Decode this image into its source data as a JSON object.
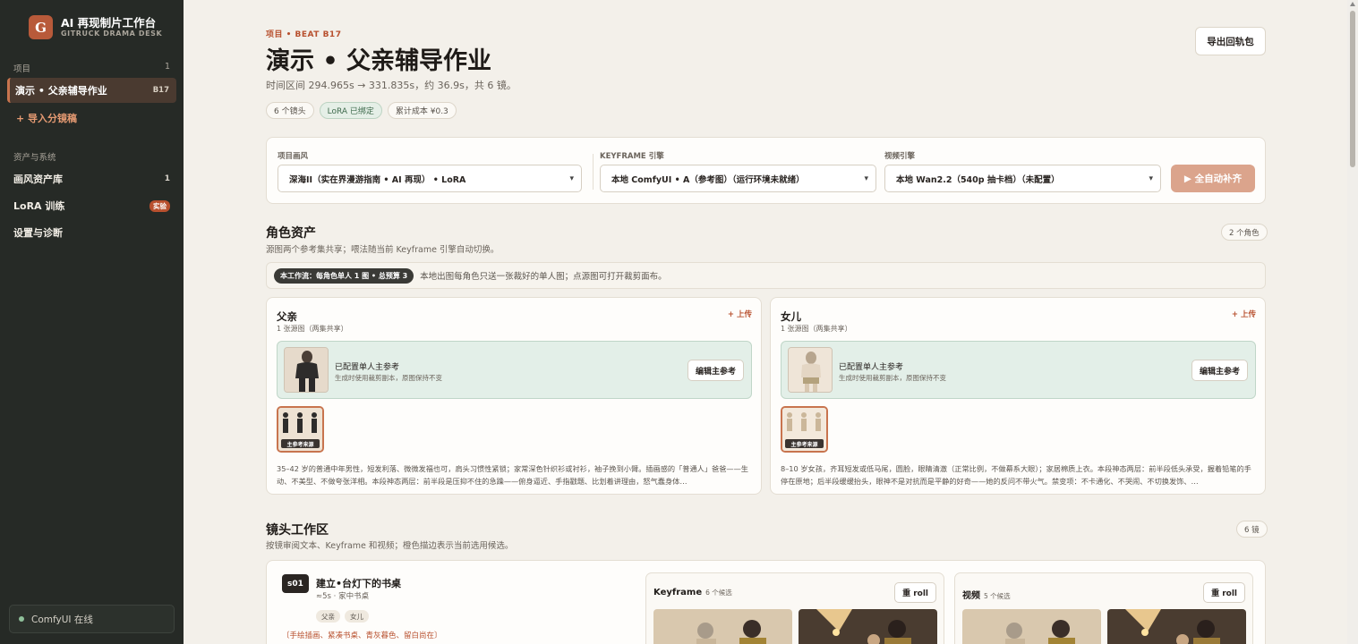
{
  "sidebar": {
    "brand_logo": "G",
    "brand_title": "AI 再现制片工作台",
    "brand_sub": "GITRUCK DRAMA DESK",
    "projects_label": "项目",
    "projects_count": "1",
    "active_project": "演示 • 父亲辅导作业",
    "active_badge": "B17",
    "import_label": "+ 导入分镜稿",
    "assets_label": "资产与系统",
    "items": [
      {
        "label": "画风资产库",
        "count": "1"
      },
      {
        "label": "LoRA 训练",
        "badge": "实验"
      },
      {
        "label": "设置与诊断"
      }
    ],
    "status": "ComfyUI 在线"
  },
  "header": {
    "eyebrow": "项目 • BEAT B17",
    "title": "演示 • 父亲辅导作业",
    "subtitle": "时间区间 294.965s → 331.835s，约 36.9s，共 6 镜。",
    "tags": [
      "6 个镜头",
      "LoRA 已绑定",
      "累计成本 ¥0.3"
    ],
    "export_label": "导出回轨包"
  },
  "engines": {
    "style_label": "项目画风",
    "style_value": "深海II（实在界漫游指南 • AI 再现） • LoRA",
    "keyframe_label": "KEYFRAME 引擎",
    "keyframe_value": "本地 ComfyUI • A（参考图）（运行环境未就绪）",
    "video_label": "视频引擎",
    "video_value": "本地 Wan2.2（540p 抽卡档）（未配置）",
    "auto_label": "▶ 全自动补齐"
  },
  "characters": {
    "title": "角色资产",
    "subtitle": "源图两个参考集共享；喂法随当前 Keyframe 引擎自动切换。",
    "count": "2 个角色",
    "info_chip": "本工作流：每角色单人 1 图 • 总预算 3",
    "info_text": "本地出图每角色只送一张裁好的单人图；点源图可打开裁剪面布。",
    "upload_label": "+ 上传",
    "ref_title": "已配置单人主参考",
    "ref_sub": "生成时使用裁剪副本，原图保持不变",
    "edit_label": "编辑主参考",
    "src_label": "主参考来源",
    "cards": [
      {
        "name": "父亲",
        "src": "1 张源图（两集共享）",
        "desc": "35–42 岁的普通中年男性，短发利落、微微发福也可，肩头习惯性紧锁；家常深色针织衫或衬衫，袖子挽到小臂。插画感的「普通人」爸爸——生动、不美型、不做夸张洋相。本段神态两层：前半段是压抑不住的急躁——俯身逼近、手指戳题、比划着讲理由，怒气蠢身体…"
      },
      {
        "name": "女儿",
        "src": "1 张源图（两集共享）",
        "desc": "8–10 岁女孩，齐耳短发或低马尾，圆脸，眼睛清澈（正常比例，不做幕系大眼）；家居棉质上衣。本段神态两层：前半段低头承受，握着铅笔的手停在原地；后半段缓缓抬头，眼神不是对抗而是平静的好奇——她的反问不带火气。禁变项：不卡通化、不哭闹、不切换发饰、…"
      }
    ]
  },
  "shots": {
    "title": "镜头工作区",
    "subtitle": "按镜审阅文本、Keyframe 和视频；橙色描边表示当前选用候选。",
    "count": "6 镜",
    "first": {
      "id": "s01",
      "title": "建立•台灯下的书桌",
      "meta": "≈5s · 家中书桌",
      "tags": [
        "父亲",
        "女儿"
      ],
      "style": "〔手绘插画、紧凑书桌、青灰暮色、留白尚在〕",
      "keyframe_title": "Keyframe",
      "keyframe_count": "6 个候选",
      "video_title": "视频",
      "video_count": "5 个候选",
      "reroll_label": "重 roll"
    }
  }
}
